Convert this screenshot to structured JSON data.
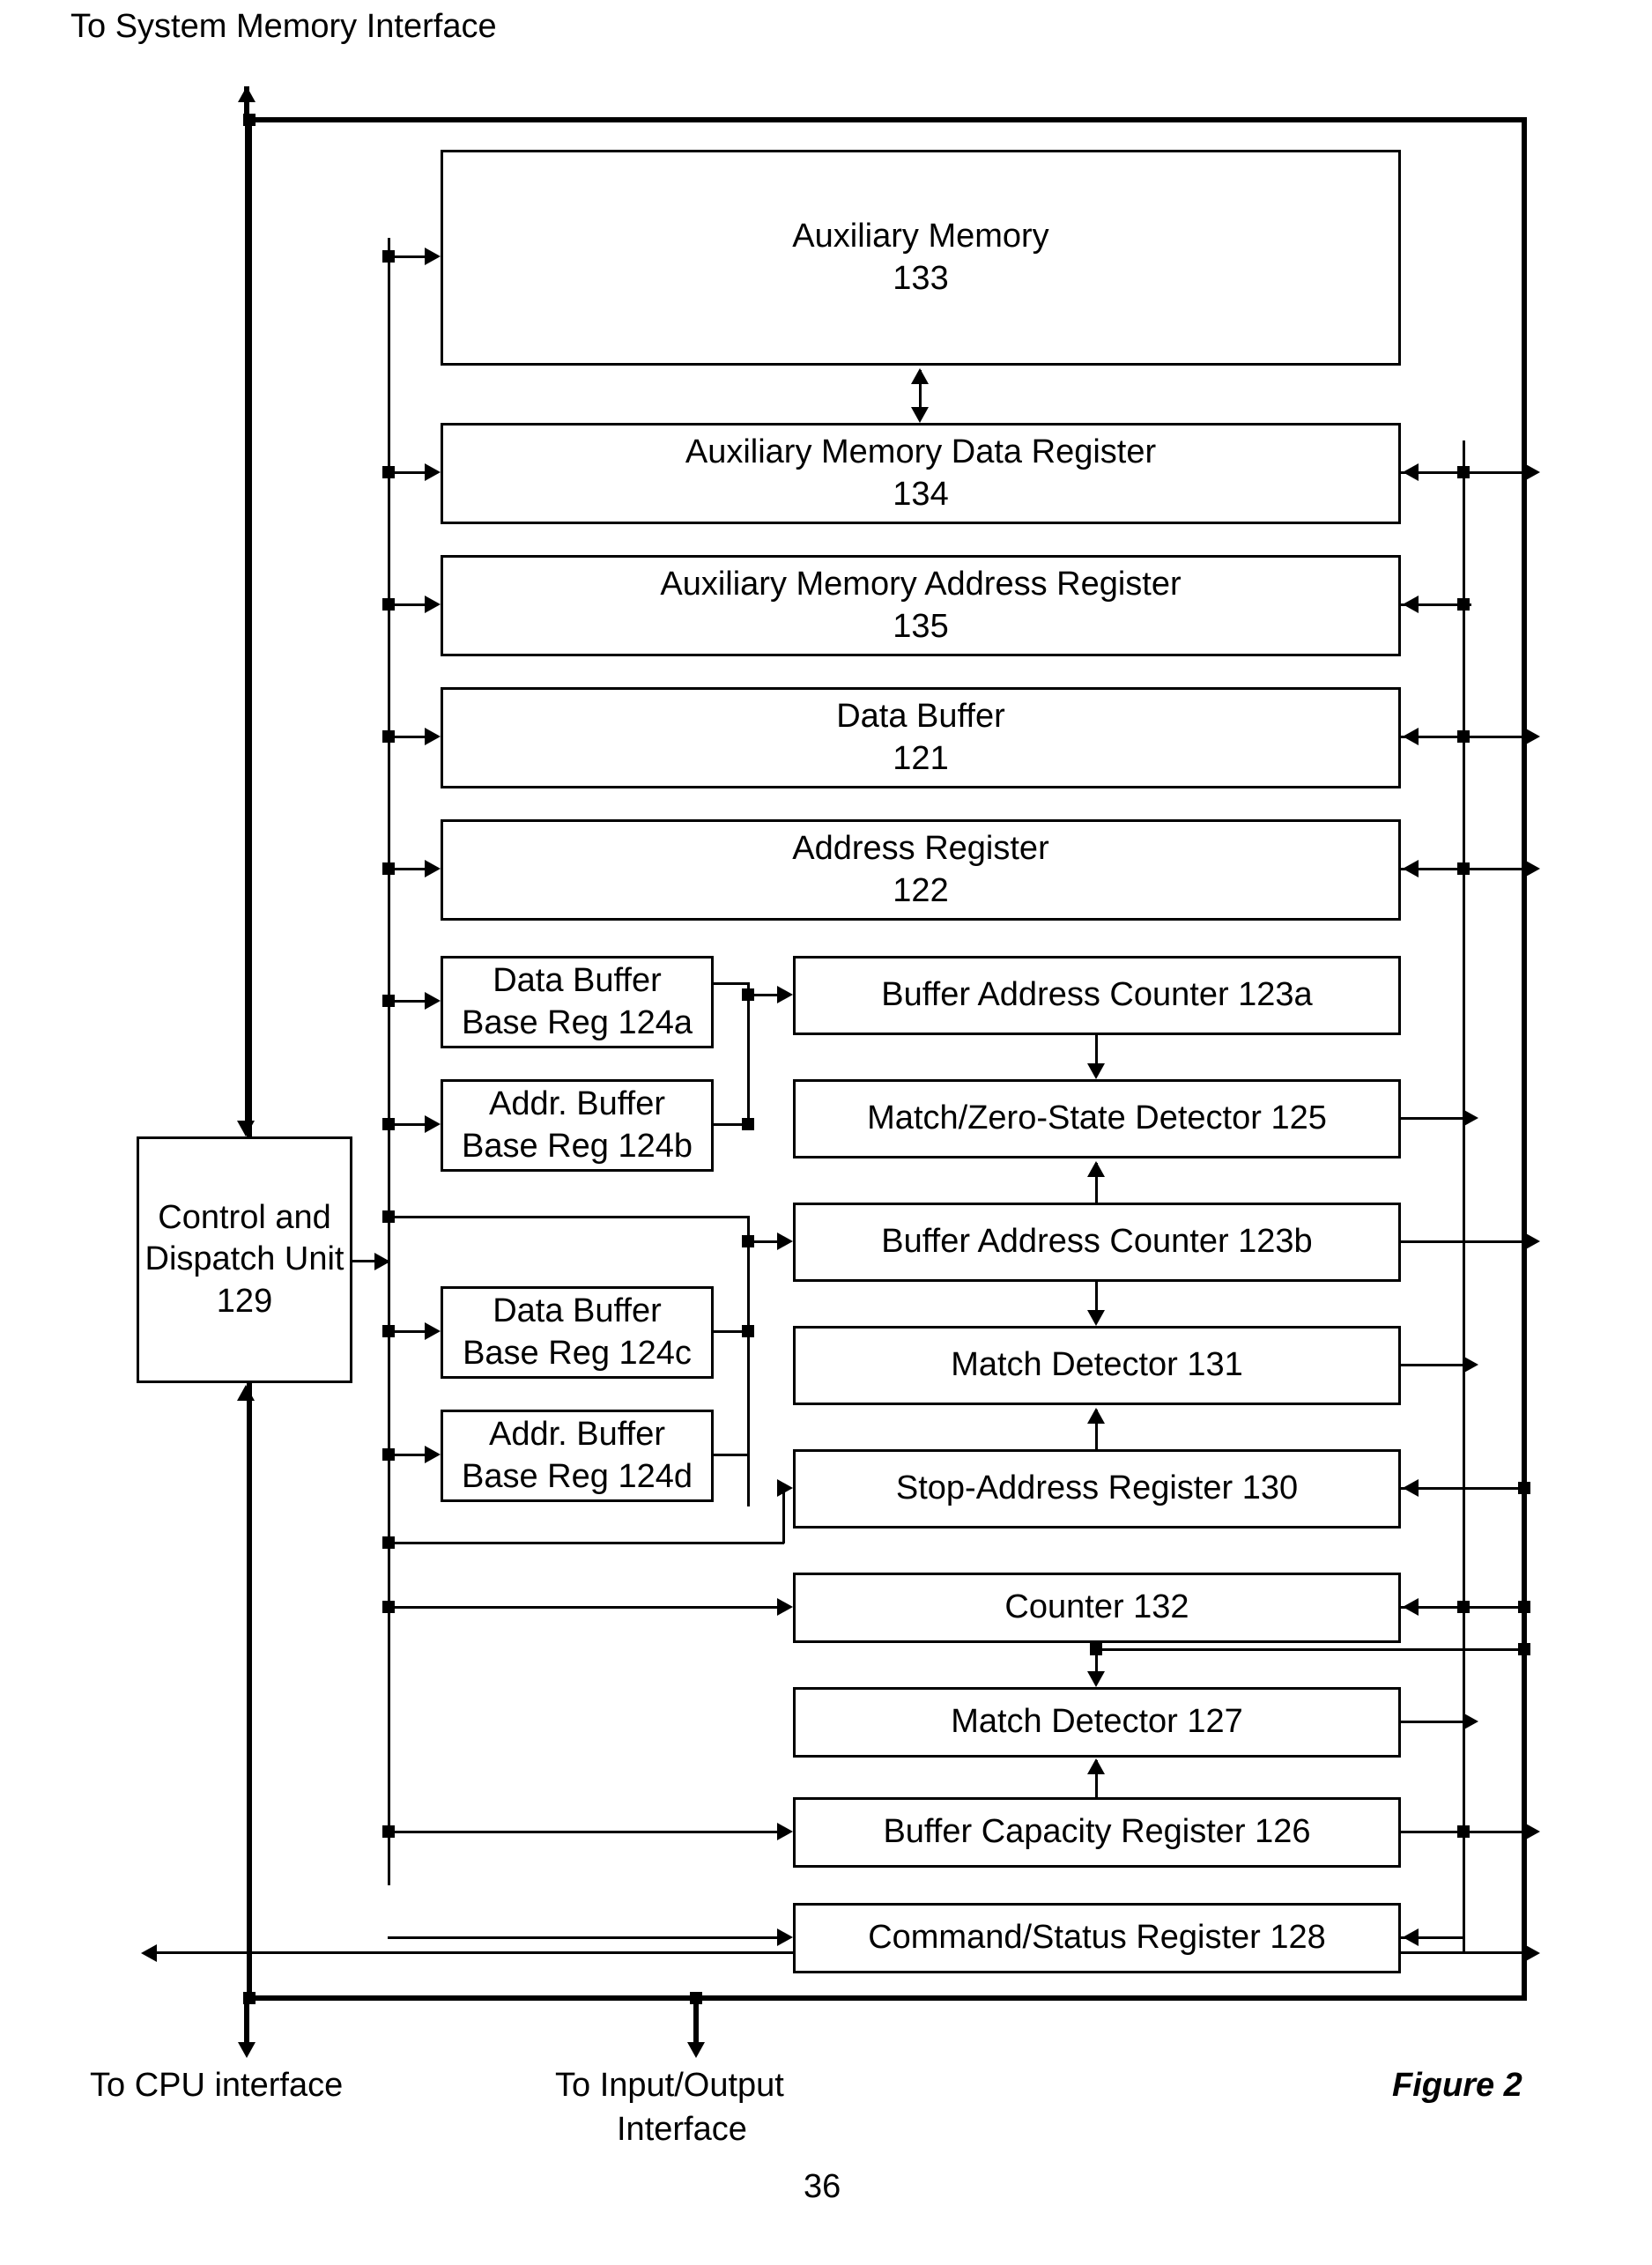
{
  "external_labels": {
    "top": "To System Memory Interface",
    "bottom_left": "To CPU interface",
    "bottom_mid_line1": "To Input/Output",
    "bottom_mid_line2": "Interface",
    "figure": "Figure 2",
    "page_number": "36"
  },
  "blocks": {
    "aux_mem": {
      "line1": "Auxiliary Memory",
      "line2": "133"
    },
    "aux_mem_data_reg": {
      "line1": "Auxiliary Memory Data Register",
      "line2": "134"
    },
    "aux_mem_addr_reg": {
      "line1": "Auxiliary Memory Address Register",
      "line2": "135"
    },
    "data_buffer": {
      "line1": "Data Buffer",
      "line2": "121"
    },
    "address_register": {
      "line1": "Address Register",
      "line2": "122"
    },
    "data_buf_base_reg_a": {
      "line1": "Data Buffer",
      "line2": "Base Reg 124a"
    },
    "addr_buf_base_reg_b": {
      "line1": "Addr.  Buffer",
      "line2": "Base Reg 124b"
    },
    "data_buf_base_reg_c": {
      "line1": "Data Buffer",
      "line2": "Base Reg 124c"
    },
    "addr_buf_base_reg_d": {
      "line1": "Addr.  Buffer",
      "line2": "Base Reg 124d"
    },
    "buf_addr_counter_a": {
      "line1": "Buffer Address Counter 123a"
    },
    "match_zero_detector": {
      "line1": "Match/Zero-State Detector 125"
    },
    "buf_addr_counter_b": {
      "line1": "Buffer Address Counter  123b"
    },
    "match_detector_131": {
      "line1": "Match Detector 131"
    },
    "stop_addr_reg": {
      "line1": "Stop-Address Register 130"
    },
    "counter": {
      "line1": "Counter 132"
    },
    "match_detector_127": {
      "line1": "Match Detector 127"
    },
    "buf_capacity_reg": {
      "line1": "Buffer Capacity Register 126"
    },
    "cmd_status_reg": {
      "line1": "Command/Status Register 128"
    },
    "control_dispatch": {
      "line1": "Control and",
      "line2": "Dispatch Unit",
      "line3": "129"
    }
  }
}
